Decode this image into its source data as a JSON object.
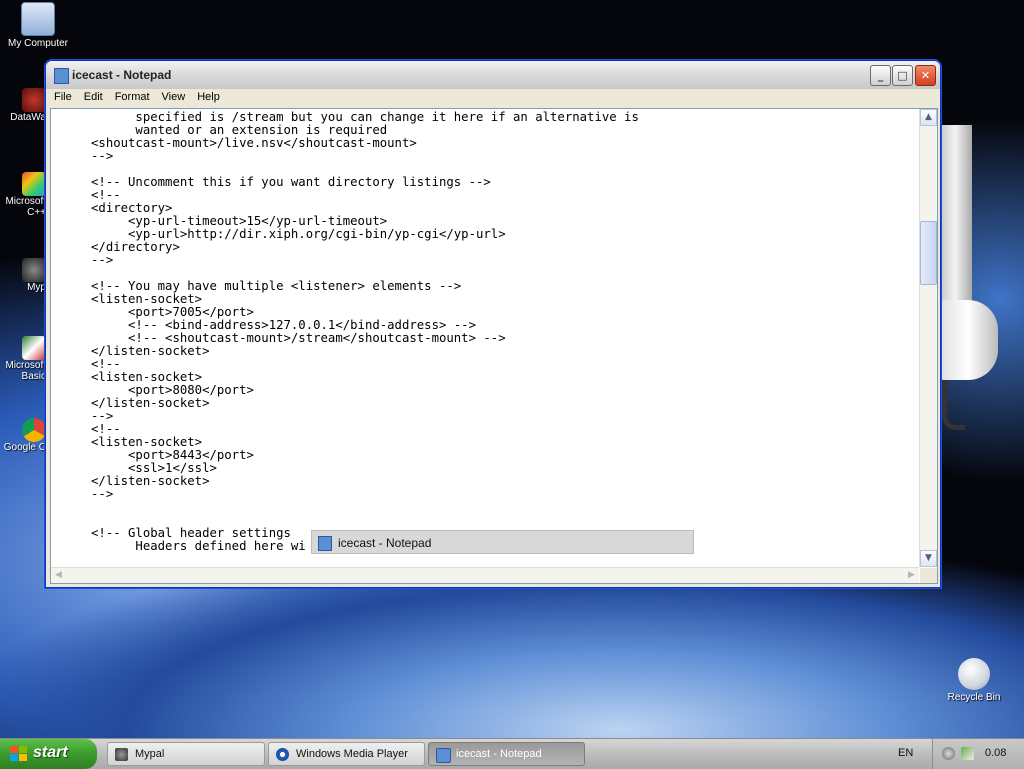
{
  "desktop": {
    "icons": [
      {
        "label": "My Computer"
      },
      {
        "label": "DataWa"
      },
      {
        "label": "Microsoft C++"
      },
      {
        "label": "Myp"
      },
      {
        "label": "Microsoft Basic"
      },
      {
        "label": "Google C"
      },
      {
        "label": "Recycle Bin"
      }
    ]
  },
  "window": {
    "title": "icecast - Notepad",
    "buttons": {
      "minimize": "_",
      "maximize": "□",
      "close": "✕"
    },
    "menu": [
      "File",
      "Edit",
      "Format",
      "View",
      "Help"
    ],
    "content_lines": [
      "      specified is /stream but you can change it here if an alternative is",
      "      wanted or an extension is required",
      "<shoutcast-mount>/live.nsv</shoutcast-mount>",
      "-->",
      "",
      "<!-- Uncomment this if you want directory listings -->",
      "<!--",
      "<directory>",
      "     <yp-url-timeout>15</yp-url-timeout>",
      "     <yp-url>http://dir.xiph.org/cgi-bin/yp-cgi</yp-url>",
      "</directory>",
      "-->",
      "",
      "<!-- You may have multiple <listener> elements -->",
      "<listen-socket>",
      "     <port>7005</port>",
      "     <!-- <bind-address>127.0.0.1</bind-address> -->",
      "     <!-- <shoutcast-mount>/stream</shoutcast-mount> -->",
      "</listen-socket>",
      "<!--",
      "<listen-socket>",
      "     <port>8080</port>",
      "</listen-socket>",
      "-->",
      "<!--",
      "<listen-socket>",
      "     <port>8443</port>",
      "     <ssl>1</ssl>",
      "</listen-socket>",
      "-->",
      "",
      "",
      "<!-- Global header settings",
      "      Headers defined here wi"
    ]
  },
  "task_tooltip": {
    "label": "icecast - Notepad"
  },
  "taskbar": {
    "start_label": "start",
    "items": [
      {
        "label": "Mypal",
        "active": false
      },
      {
        "label": "Windows Media Player",
        "active": false
      },
      {
        "label": "icecast - Notepad",
        "active": true
      }
    ],
    "language": "EN",
    "clock": "0.08"
  },
  "colors": {
    "title_bar": "#dcdcdc",
    "close_button": "#d43f1c",
    "start_button": "#3a9a2c",
    "taskbar": "#bdbdbd"
  }
}
